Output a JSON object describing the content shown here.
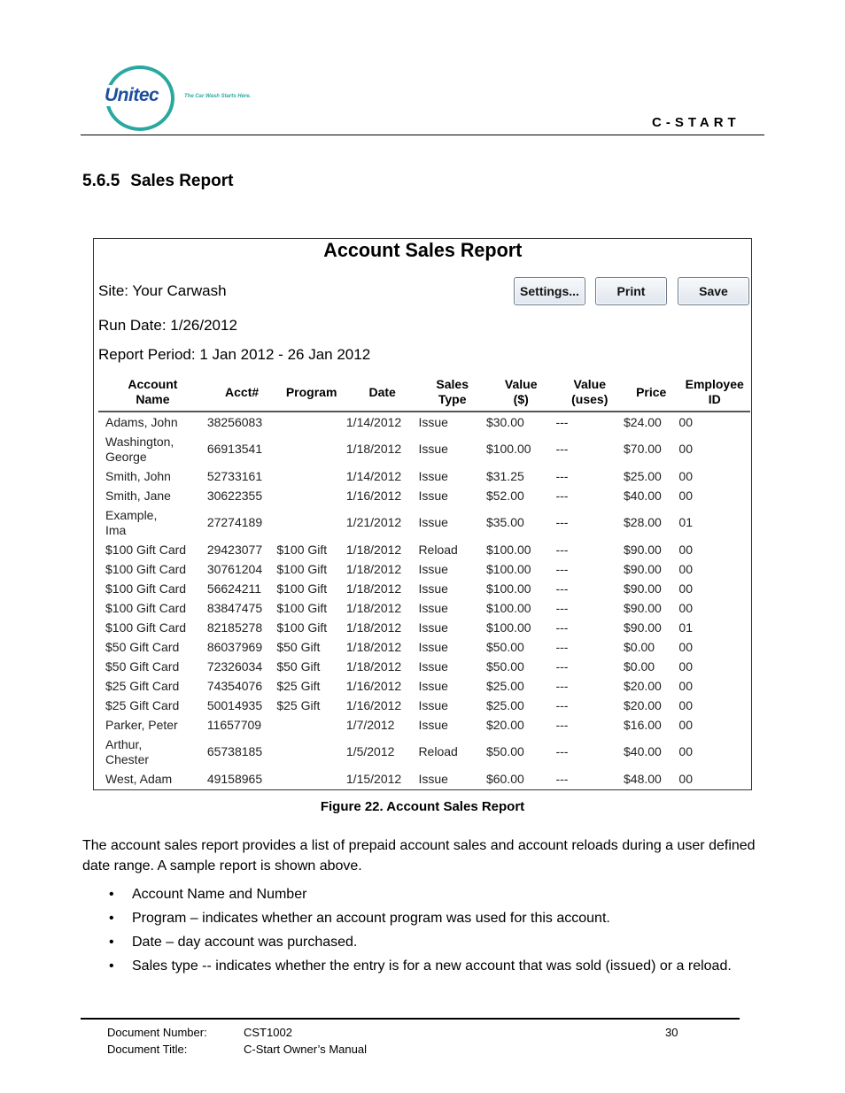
{
  "header": {
    "logo_text": "Unitec",
    "tagline": "The Car Wash Starts Here.",
    "brand": "C-START"
  },
  "section": {
    "number": "5.6.5",
    "title": "Sales Report"
  },
  "report": {
    "title": "Account Sales Report",
    "site": "Site: Your Carwash",
    "run_date": "Run Date: 1/26/2012",
    "period": "Report Period: 1 Jan 2012 - 26 Jan 2012",
    "buttons": {
      "settings": "Settings...",
      "print": "Print",
      "save": "Save"
    },
    "columns": [
      {
        "line1": "Account",
        "line2": "Name"
      },
      {
        "line1": "Acct#",
        "line2": ""
      },
      {
        "line1": "Program",
        "line2": ""
      },
      {
        "line1": "Date",
        "line2": ""
      },
      {
        "line1": "Sales",
        "line2": "Type"
      },
      {
        "line1": "Value",
        "line2": "($)"
      },
      {
        "line1": "Value",
        "line2": "(uses)"
      },
      {
        "line1": "Price",
        "line2": ""
      },
      {
        "line1": "Employee",
        "line2": "ID"
      }
    ],
    "rows": [
      {
        "name1": "Adams, John",
        "name2": "",
        "acct": "38256083",
        "program": "",
        "date": "1/14/2012",
        "type": "Issue",
        "value": "$30.00",
        "uses": "---",
        "price": "$24.00",
        "emp": "00"
      },
      {
        "name1": "Washington,",
        "name2": "George",
        "acct": "66913541",
        "program": "",
        "date": "1/18/2012",
        "type": "Issue",
        "value": "$100.00",
        "uses": "---",
        "price": "$70.00",
        "emp": "00"
      },
      {
        "name1": "Smith, John",
        "name2": "",
        "acct": "52733161",
        "program": "",
        "date": "1/14/2012",
        "type": "Issue",
        "value": "$31.25",
        "uses": "---",
        "price": "$25.00",
        "emp": "00"
      },
      {
        "name1": "Smith, Jane",
        "name2": "",
        "acct": "30622355",
        "program": "",
        "date": "1/16/2012",
        "type": "Issue",
        "value": "$52.00",
        "uses": "---",
        "price": "$40.00",
        "emp": "00"
      },
      {
        "name1": "Example,",
        "name2": "Ima",
        "acct": "27274189",
        "program": "",
        "date": "1/21/2012",
        "type": "Issue",
        "value": "$35.00",
        "uses": "---",
        "price": "$28.00",
        "emp": "01"
      },
      {
        "name1": "$100 Gift Card",
        "name2": "",
        "acct": "29423077",
        "program": "$100 Gift",
        "date": "1/18/2012",
        "type": "Reload",
        "value": "$100.00",
        "uses": "---",
        "price": "$90.00",
        "emp": "00"
      },
      {
        "name1": "$100 Gift Card",
        "name2": "",
        "acct": "30761204",
        "program": "$100 Gift",
        "date": "1/18/2012",
        "type": "Issue",
        "value": "$100.00",
        "uses": "---",
        "price": "$90.00",
        "emp": "00"
      },
      {
        "name1": "$100 Gift Card",
        "name2": "",
        "acct": "56624211",
        "program": "$100 Gift",
        "date": "1/18/2012",
        "type": "Issue",
        "value": "$100.00",
        "uses": "---",
        "price": "$90.00",
        "emp": "00"
      },
      {
        "name1": "$100 Gift Card",
        "name2": "",
        "acct": "83847475",
        "program": "$100 Gift",
        "date": "1/18/2012",
        "type": "Issue",
        "value": "$100.00",
        "uses": "---",
        "price": "$90.00",
        "emp": "00"
      },
      {
        "name1": "$100 Gift Card",
        "name2": "",
        "acct": "82185278",
        "program": "$100 Gift",
        "date": "1/18/2012",
        "type": "Issue",
        "value": "$100.00",
        "uses": "---",
        "price": "$90.00",
        "emp": "01"
      },
      {
        "name1": "$50 Gift Card",
        "name2": "",
        "acct": "86037969",
        "program": "$50 Gift",
        "date": "1/18/2012",
        "type": "Issue",
        "value": "$50.00",
        "uses": "---",
        "price": "$0.00",
        "emp": "00"
      },
      {
        "name1": "$50 Gift Card",
        "name2": "",
        "acct": "72326034",
        "program": "$50 Gift",
        "date": "1/18/2012",
        "type": "Issue",
        "value": "$50.00",
        "uses": "---",
        "price": "$0.00",
        "emp": "00"
      },
      {
        "name1": "$25 Gift Card",
        "name2": "",
        "acct": "74354076",
        "program": "$25 Gift",
        "date": "1/16/2012",
        "type": "Issue",
        "value": "$25.00",
        "uses": "---",
        "price": "$20.00",
        "emp": "00"
      },
      {
        "name1": "$25 Gift Card",
        "name2": "",
        "acct": "50014935",
        "program": "$25 Gift",
        "date": "1/16/2012",
        "type": "Issue",
        "value": "$25.00",
        "uses": "---",
        "price": "$20.00",
        "emp": "00"
      },
      {
        "name1": "Parker, Peter",
        "name2": "",
        "acct": "11657709",
        "program": "",
        "date": "1/7/2012",
        "type": "Issue",
        "value": "$20.00",
        "uses": "---",
        "price": "$16.00",
        "emp": "00"
      },
      {
        "name1": "Arthur,",
        "name2": "Chester",
        "acct": "65738185",
        "program": "",
        "date": "1/5/2012",
        "type": "Reload",
        "value": "$50.00",
        "uses": "---",
        "price": "$40.00",
        "emp": "00"
      },
      {
        "name1": "West, Adam",
        "name2": "",
        "acct": "49158965",
        "program": "",
        "date": "1/15/2012",
        "type": "Issue",
        "value": "$60.00",
        "uses": "---",
        "price": "$48.00",
        "emp": "00"
      }
    ]
  },
  "figure_caption": "Figure 22. Account Sales Report",
  "body": {
    "paragraph": "The account sales report provides a list of prepaid account sales and account reloads during a user defined date range. A sample report is shown above.",
    "bullets": [
      "Account Name and Number",
      "Program – indicates whether an account program was used for this account.",
      "Date – day account was purchased.",
      "Sales type -- indicates whether the entry is for a new account that was sold  (issued) or a reload."
    ]
  },
  "footer": {
    "doc_number_label": "Document Number:",
    "doc_number": "CST1002",
    "doc_title_label": "Document Title:",
    "doc_title": "C-Start Owner’s Manual",
    "page": "30"
  }
}
